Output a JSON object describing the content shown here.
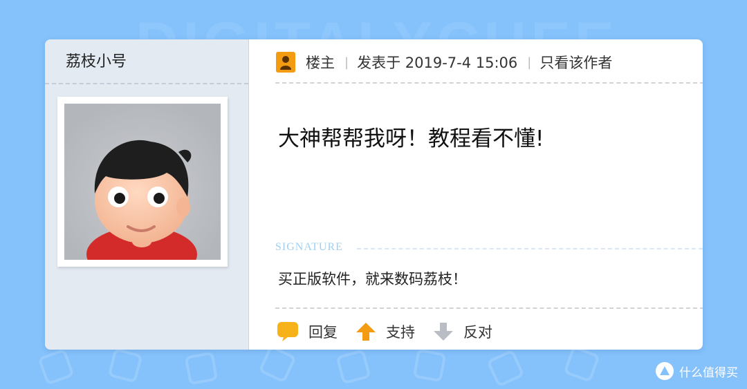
{
  "background_watermark": "DIGITALYCHEE",
  "post": {
    "username": "荔枝小号",
    "role": "楼主",
    "posted_time": "发表于 2019-7-4 15:06",
    "author_only": "只看该作者",
    "content": "大神帮帮我呀！教程看不懂!",
    "signature_label": "SIGNATURE",
    "signature": "买正版软件，就来数码荔枝！"
  },
  "actions": {
    "reply": "回复",
    "support": "支持",
    "oppose": "反对"
  },
  "corner_watermark": "什么值得买",
  "colors": {
    "background": "#85c1fb",
    "sidebar": "#e3eaf2",
    "host_badge": "#f39c12",
    "reply_icon": "#f7b21a",
    "support_icon": "#f39c12",
    "oppose_icon": "#b9bec4"
  },
  "icons": [
    "host-badge-icon",
    "speech-bubble-icon",
    "up-arrow-icon",
    "down-arrow-icon"
  ]
}
